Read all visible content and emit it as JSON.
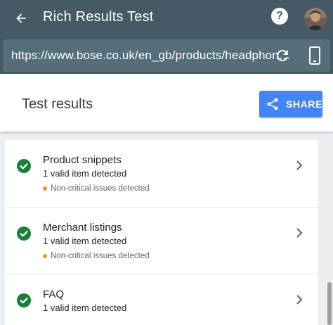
{
  "app_bar": {
    "title": "Rich Results Test",
    "url": "https://www.bose.co.uk/en_gb/products/headphon…"
  },
  "results_header": {
    "title": "Test results",
    "share_label": "SHARE"
  },
  "results": [
    {
      "title": "Product snippets",
      "subtitle": "1 valid item detected",
      "warning": "Non-critical issues detected"
    },
    {
      "title": "Merchant listings",
      "subtitle": "1 valid item detected",
      "warning": "Non-critical issues detected"
    },
    {
      "title": "FAQ",
      "subtitle": "1 valid item detected"
    }
  ],
  "colors": {
    "app_bar": "#455a64",
    "url_bar": "#546e7a",
    "accent": "#4285f4",
    "valid": "#188038",
    "warning": "#f29900"
  },
  "icons": {
    "back": "arrow-back-icon",
    "help": "help-icon",
    "refresh": "refresh-icon",
    "device": "smartphone-icon",
    "share": "share-icon",
    "valid": "check-circle-icon",
    "open": "chevron-right-icon"
  }
}
